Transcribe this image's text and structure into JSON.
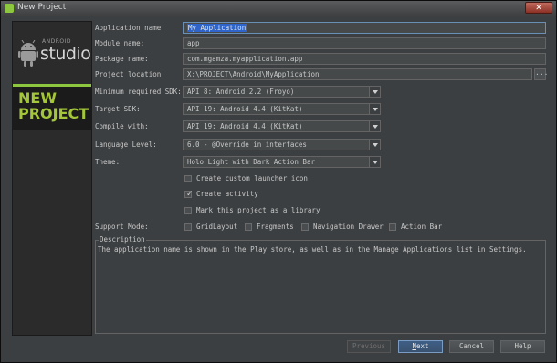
{
  "window": {
    "title": "New Project"
  },
  "sidebar": {
    "logo_android": "ANDROID",
    "logo_studio": "studio",
    "banner_line1": "NEW",
    "banner_line2": "PROJECT"
  },
  "form": {
    "app_name": {
      "label": "Application name:",
      "value": "My Application"
    },
    "module_name": {
      "label": "Module name:",
      "value": "app"
    },
    "package_name": {
      "label": "Package name:",
      "value": "com.mgamza.myapplication.app"
    },
    "project_location": {
      "label": "Project location:",
      "value": "X:\\PROJECT\\Android\\MyApplication",
      "browse": "..."
    },
    "min_sdk": {
      "label": "Minimum required SDK:",
      "value": "API 8: Android 2.2 (Froyo)"
    },
    "target_sdk": {
      "label": "Target SDK:",
      "value": "API 19: Android 4.4 (KitKat)"
    },
    "compile_with": {
      "label": "Compile with:",
      "value": "API 19: Android 4.4 (KitKat)"
    },
    "language_level": {
      "label": "Language Level:",
      "value": "6.0 - @Override in interfaces"
    },
    "theme": {
      "label": "Theme:",
      "value": "Holo Light with Dark Action Bar"
    }
  },
  "options": {
    "custom_launcher_icon": {
      "label": "Create custom launcher icon",
      "checked": false
    },
    "create_activity": {
      "label": "Create activity",
      "checked": true
    },
    "mark_library": {
      "label": "Mark this project as a library",
      "checked": false
    }
  },
  "support_mode": {
    "label": "Support Mode:",
    "items": [
      {
        "label": "GridLayout",
        "checked": false
      },
      {
        "label": "Fragments",
        "checked": false
      },
      {
        "label": "Navigation Drawer",
        "checked": false
      },
      {
        "label": "Action Bar",
        "checked": false
      }
    ]
  },
  "description": {
    "legend": "Description",
    "text": "The application name is shown in the Play store, as well as in the Manage Applications list in Settings."
  },
  "buttons": {
    "previous": "Previous",
    "next_mnemonic": "N",
    "next_rest": "ext",
    "cancel": "Cancel",
    "help": "Help"
  },
  "colors": {
    "background": "#3c3f41",
    "accent_green": "#a4c639",
    "selection": "#2f65ca",
    "default_button": "#3f5f86"
  }
}
